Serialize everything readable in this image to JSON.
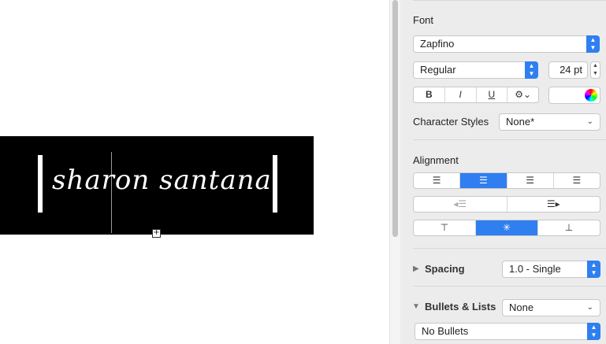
{
  "canvas": {
    "text_content": "sharon santana"
  },
  "inspector": {
    "font_section_label": "Font",
    "font_family": "Zapfino",
    "font_style": "Regular",
    "font_size": "24 pt",
    "bold_label": "B",
    "italic_label": "I",
    "underline_label": "U",
    "character_styles_label": "Character Styles",
    "character_styles_value": "None*",
    "alignment_label": "Alignment",
    "spacing_label": "Spacing",
    "spacing_value": "1.0 - Single",
    "bullets_label": "Bullets & Lists",
    "bullets_value": "None",
    "bullets_style": "No Bullets"
  },
  "colors": {
    "accent": "#2f7ff0",
    "panel": "#ececec",
    "textbox": "#000000"
  }
}
